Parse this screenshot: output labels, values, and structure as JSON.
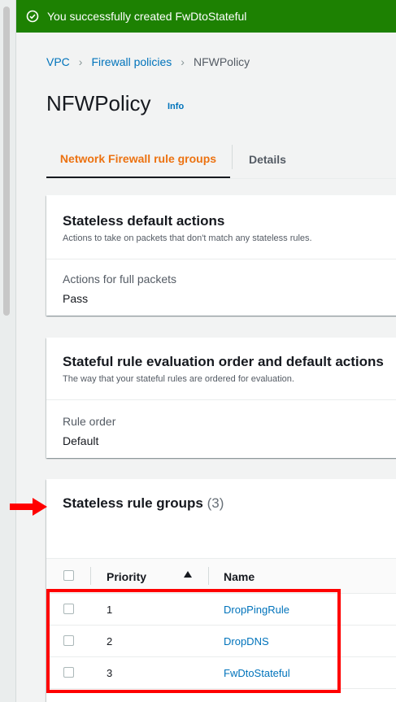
{
  "flash": {
    "message": "You successfully created FwDtoStateful",
    "status_color": "#1d8102"
  },
  "breadcrumb": {
    "items": [
      "VPC",
      "Firewall policies"
    ],
    "current": "NFWPolicy"
  },
  "page": {
    "title": "NFWPolicy",
    "info_label": "Info"
  },
  "tabs": [
    {
      "label": "Network Firewall rule groups",
      "active": true
    },
    {
      "label": "Details",
      "active": false
    }
  ],
  "stateless_defaults": {
    "title": "Stateless default actions",
    "description": "Actions to take on packets that don't match any stateless rules.",
    "field_label": "Actions for full packets",
    "field_value": "Pass"
  },
  "stateful_order": {
    "title": "Stateful rule evaluation order and default actions",
    "description": "The way that your stateful rules are ordered for evaluation.",
    "field_label": "Rule order",
    "field_value": "Default"
  },
  "stateless_groups": {
    "title": "Stateless rule groups",
    "count": "(3)",
    "columns": {
      "priority": "Priority",
      "name": "Name"
    },
    "rows": [
      {
        "priority": "1",
        "name": "DropPingRule"
      },
      {
        "priority": "2",
        "name": "DropDNS"
      },
      {
        "priority": "3",
        "name": "FwDtoStateful"
      }
    ]
  },
  "colors": {
    "accent": "#ec7211",
    "link": "#0073bb",
    "annotation": "#ff0000"
  },
  "icons": {
    "flash": "check-circle-icon",
    "sort": "sort-ascending-icon",
    "annotation": "right-arrow-icon"
  }
}
